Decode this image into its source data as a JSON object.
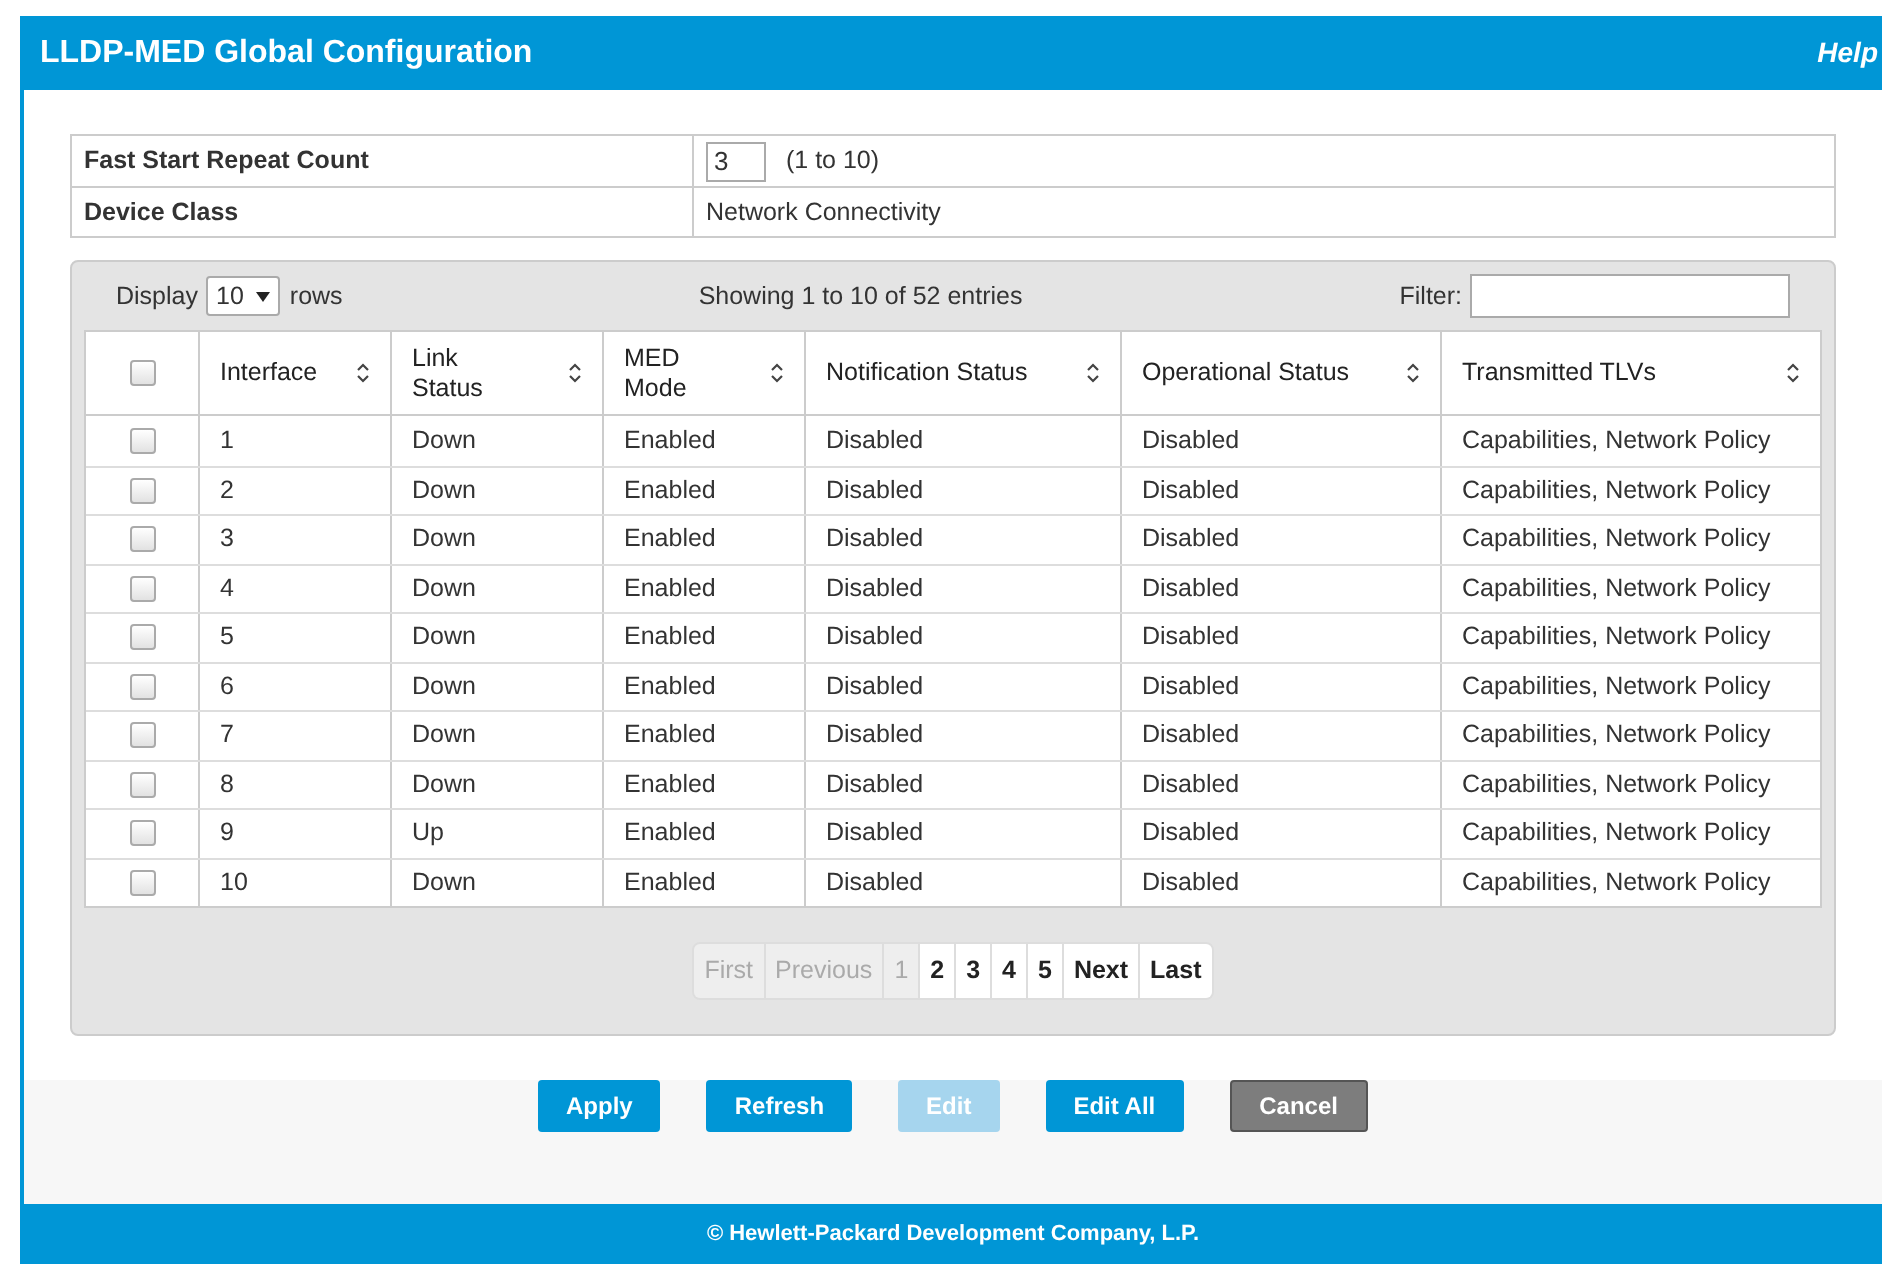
{
  "header": {
    "title": "LLDP-MED Global Configuration",
    "help": "Help"
  },
  "settings": [
    {
      "label": "Fast Start Repeat Count",
      "kind": "input",
      "value": "3",
      "hint": "(1 to 10)"
    },
    {
      "label": "Device Class",
      "kind": "text",
      "value": "Network Connectivity"
    }
  ],
  "table_controls": {
    "display_label": "Display",
    "rows_value": "10",
    "rows_label": "rows",
    "info": "Showing 1 to 10 of 52 entries",
    "filter_label": "Filter:"
  },
  "table": {
    "select_all_checked": false,
    "columns": [
      "Interface",
      "Link Status",
      "MED Mode",
      "Notification Status",
      "Operational Status",
      "Transmitted TLVs"
    ],
    "rows": [
      {
        "checked": false,
        "cells": [
          "1",
          "Down",
          "Enabled",
          "Disabled",
          "Disabled",
          "Capabilities, Network Policy"
        ]
      },
      {
        "checked": false,
        "cells": [
          "2",
          "Down",
          "Enabled",
          "Disabled",
          "Disabled",
          "Capabilities, Network Policy"
        ]
      },
      {
        "checked": false,
        "cells": [
          "3",
          "Down",
          "Enabled",
          "Disabled",
          "Disabled",
          "Capabilities, Network Policy"
        ]
      },
      {
        "checked": false,
        "cells": [
          "4",
          "Down",
          "Enabled",
          "Disabled",
          "Disabled",
          "Capabilities, Network Policy"
        ]
      },
      {
        "checked": false,
        "cells": [
          "5",
          "Down",
          "Enabled",
          "Disabled",
          "Disabled",
          "Capabilities, Network Policy"
        ]
      },
      {
        "checked": false,
        "cells": [
          "6",
          "Down",
          "Enabled",
          "Disabled",
          "Disabled",
          "Capabilities, Network Policy"
        ]
      },
      {
        "checked": false,
        "cells": [
          "7",
          "Down",
          "Enabled",
          "Disabled",
          "Disabled",
          "Capabilities, Network Policy"
        ]
      },
      {
        "checked": false,
        "cells": [
          "8",
          "Down",
          "Enabled",
          "Disabled",
          "Disabled",
          "Capabilities, Network Policy"
        ]
      },
      {
        "checked": false,
        "cells": [
          "9",
          "Up",
          "Enabled",
          "Disabled",
          "Disabled",
          "Capabilities, Network Policy"
        ]
      },
      {
        "checked": false,
        "cells": [
          "10",
          "Down",
          "Enabled",
          "Disabled",
          "Disabled",
          "Capabilities, Network Policy"
        ]
      }
    ]
  },
  "pagination": [
    {
      "label": "First",
      "disabled": true
    },
    {
      "label": "Previous",
      "disabled": true
    },
    {
      "label": "1",
      "disabled": true
    },
    {
      "label": "2",
      "disabled": false
    },
    {
      "label": "3",
      "disabled": false
    },
    {
      "label": "4",
      "disabled": false
    },
    {
      "label": "5",
      "disabled": false
    },
    {
      "label": "Next",
      "disabled": false
    },
    {
      "label": "Last",
      "disabled": false
    }
  ],
  "buttons": [
    {
      "label": "Apply",
      "kind": "primary",
      "disabled": false
    },
    {
      "label": "Refresh",
      "kind": "primary",
      "disabled": false
    },
    {
      "label": "Edit",
      "kind": "primary",
      "disabled": true
    },
    {
      "label": "Edit All",
      "kind": "primary",
      "disabled": false
    },
    {
      "label": "Cancel",
      "kind": "secondary",
      "disabled": false
    }
  ],
  "footer": "© Hewlett-Packard Development Company, L.P."
}
